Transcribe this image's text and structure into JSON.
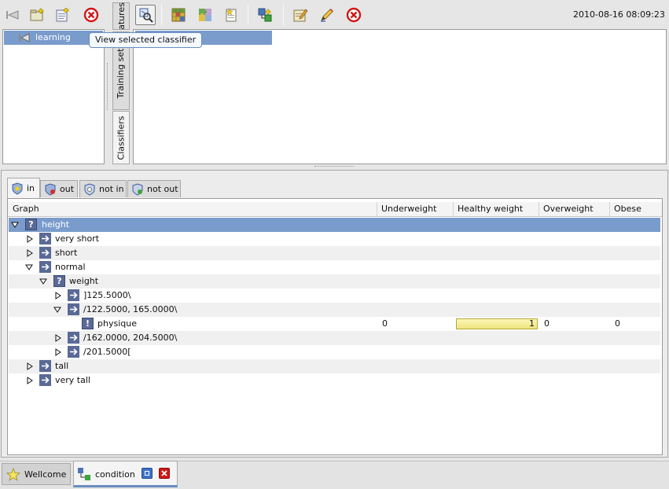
{
  "toolbar_left": {
    "icons": [
      "back-arrow-icon",
      "new-folder-icon",
      "add-document-icon",
      "cancel-icon"
    ]
  },
  "toolbar_right": {
    "icons": [
      "view-classifier-icon",
      "matrix-icon",
      "puzzle-icon",
      "new-file-icon",
      "add-node-icon",
      "edit-icon",
      "pencil-icon",
      "cancel-icon"
    ]
  },
  "datetime": "2010-08-16 08:09:23",
  "tree_panel": {
    "selected_item": "learning"
  },
  "tooltip": "View selected classifier",
  "side_tabs": {
    "features": "atures",
    "training_sets": "Training sets",
    "classifiers": "Classifiers"
  },
  "view_tabs": [
    {
      "label": "in",
      "icon": "shield-in-icon"
    },
    {
      "label": "out",
      "icon": "shield-out-icon"
    },
    {
      "label": "not in",
      "icon": "shield-not-in-icon"
    },
    {
      "label": "not out",
      "icon": "shield-not-out-icon"
    }
  ],
  "columns": {
    "graph": "Graph",
    "underweight": "Underweight",
    "healthy": "Healthy weight",
    "overweight": "Overweight",
    "obese": "Obese"
  },
  "tree_rows": [
    {
      "label": "height",
      "node": "question",
      "expander": "expanded"
    },
    {
      "label": "very short",
      "node": "arrow",
      "expander": "collapsed"
    },
    {
      "label": "short",
      "node": "arrow",
      "expander": "collapsed"
    },
    {
      "label": "normal",
      "node": "arrow",
      "expander": "expanded"
    },
    {
      "label": "weight",
      "node": "question",
      "expander": "expanded"
    },
    {
      "label": "]125.5000\\",
      "node": "arrow",
      "expander": "collapsed"
    },
    {
      "label": "/122.5000, 165.0000\\",
      "node": "arrow",
      "expander": "expanded"
    },
    {
      "label": "physique",
      "node": "exclamation",
      "expander": "none",
      "values": {
        "underweight": "0",
        "healthy": "1",
        "overweight": "0",
        "obese": "0"
      },
      "healthy_fill": 1.0
    },
    {
      "label": "/162.0000, 204.5000\\",
      "node": "arrow",
      "expander": "collapsed"
    },
    {
      "label": "/201.5000[",
      "node": "arrow",
      "expander": "collapsed"
    },
    {
      "label": "tall",
      "node": "arrow",
      "expander": "collapsed"
    },
    {
      "label": "very tall",
      "node": "arrow",
      "expander": "collapsed"
    }
  ],
  "taskbar": {
    "items": [
      {
        "label": "Wellcome",
        "icon": "star-icon"
      },
      {
        "label": "condition",
        "icon": "classifier-icon"
      }
    ],
    "buttons": [
      "maximize-icon",
      "close-icon"
    ]
  },
  "colors": {
    "selection": "#7a9ccc",
    "progress_fill": "#f3ec8c",
    "progress_border": "#b9a73a",
    "cancel_red": "#d01818"
  }
}
